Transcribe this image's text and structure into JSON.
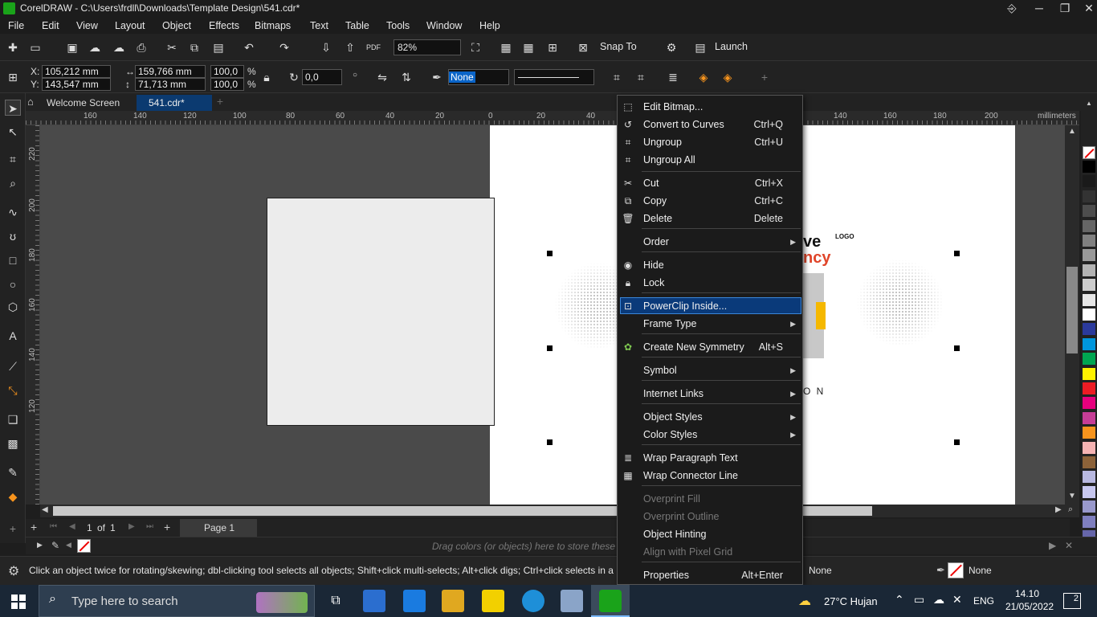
{
  "window": {
    "title": "CorelDRAW - C:\\Users\\frdll\\Downloads\\Template Design\\541.cdr*",
    "controls": [
      "⎆",
      "─",
      "❐",
      "✕"
    ]
  },
  "menu": [
    "File",
    "Edit",
    "View",
    "Layout",
    "Object",
    "Effects",
    "Bitmaps",
    "Text",
    "Table",
    "Tools",
    "Window",
    "Help"
  ],
  "std_toolbar": {
    "zoom": "82%",
    "snap_to": "Snap To",
    "launch": "Launch",
    "pdf_label": "PDF"
  },
  "property_bar": {
    "x_label": "X:",
    "x": "105,212 mm",
    "y_label": "Y:",
    "y": "143,547 mm",
    "width": "159,766 mm",
    "height": "71,713 mm",
    "scale_w": "100,0",
    "scale_h": "100,0",
    "percent": "%",
    "rotation": "0,0",
    "outline": "None"
  },
  "tabs": {
    "welcome": "Welcome Screen",
    "doc": "541.cdr*"
  },
  "rulers": {
    "h_ticks": [
      "160",
      "140",
      "120",
      "100",
      "80",
      "60",
      "40",
      "20",
      "0",
      "20",
      "40",
      "140",
      "160",
      "180",
      "200"
    ],
    "v_ticks": [
      "220",
      "200",
      "180",
      "160",
      "140",
      "120"
    ],
    "unit": "millimeters"
  },
  "design_preview": {
    "logo": "LOGO",
    "frag_ve": "ve",
    "frag_ncy": "ncy",
    "frag_on": "O N"
  },
  "page_nav": {
    "current": "1",
    "of": "of",
    "total": "1",
    "page_tab": "Page 1"
  },
  "color_docker_hint": "Drag colors (or objects) here to store these co",
  "status": {
    "hint": "Click an object twice for rotating/skewing; dbl-clicking tool selects all objects; Shift+click multi-selects; Alt+click digs; Ctrl+click selects in a",
    "fill": "None",
    "outline": "None"
  },
  "context_menu": {
    "items": [
      {
        "label": "Edit Bitmap...",
        "shortcut": "",
        "submenu": false,
        "disabled": false,
        "icon": "edit-bitmap-icon"
      },
      {
        "label": "Convert to Curves",
        "shortcut": "Ctrl+Q",
        "submenu": false,
        "disabled": false,
        "icon": "convert-curves-icon"
      },
      {
        "label": "Ungroup",
        "shortcut": "Ctrl+U",
        "submenu": false,
        "disabled": false,
        "icon": "ungroup-icon"
      },
      {
        "label": "Ungroup All",
        "shortcut": "",
        "submenu": false,
        "disabled": false,
        "icon": "ungroup-all-icon"
      },
      {
        "label": "Cut",
        "shortcut": "Ctrl+X",
        "submenu": false,
        "disabled": false,
        "icon": "cut-icon"
      },
      {
        "label": "Copy",
        "shortcut": "Ctrl+C",
        "submenu": false,
        "disabled": false,
        "icon": "copy-icon"
      },
      {
        "label": "Delete",
        "shortcut": "Delete",
        "submenu": false,
        "disabled": false,
        "icon": "trash-icon"
      },
      {
        "label": "Order",
        "shortcut": "",
        "submenu": true,
        "disabled": false,
        "icon": ""
      },
      {
        "label": "Hide",
        "shortcut": "",
        "submenu": false,
        "disabled": false,
        "icon": "eye-icon"
      },
      {
        "label": "Lock",
        "shortcut": "",
        "submenu": false,
        "disabled": false,
        "icon": "lock-icon"
      },
      {
        "label": "PowerClip Inside...",
        "shortcut": "",
        "submenu": false,
        "disabled": false,
        "icon": "powerclip-icon"
      },
      {
        "label": "Frame Type",
        "shortcut": "",
        "submenu": true,
        "disabled": false,
        "icon": ""
      },
      {
        "label": "Create New Symmetry",
        "shortcut": "Alt+S",
        "submenu": false,
        "disabled": false,
        "icon": "symmetry-icon"
      },
      {
        "label": "Symbol",
        "shortcut": "",
        "submenu": true,
        "disabled": false,
        "icon": ""
      },
      {
        "label": "Internet Links",
        "shortcut": "",
        "submenu": true,
        "disabled": false,
        "icon": ""
      },
      {
        "label": "Object Styles",
        "shortcut": "",
        "submenu": true,
        "disabled": false,
        "icon": ""
      },
      {
        "label": "Color Styles",
        "shortcut": "",
        "submenu": true,
        "disabled": false,
        "icon": ""
      },
      {
        "label": "Wrap Paragraph Text",
        "shortcut": "",
        "submenu": false,
        "disabled": false,
        "icon": "wrap-text-icon"
      },
      {
        "label": "Wrap Connector Line",
        "shortcut": "",
        "submenu": false,
        "disabled": false,
        "icon": "wrap-connector-icon"
      },
      {
        "label": "Overprint Fill",
        "shortcut": "",
        "submenu": false,
        "disabled": true,
        "icon": ""
      },
      {
        "label": "Overprint Outline",
        "shortcut": "",
        "submenu": false,
        "disabled": true,
        "icon": ""
      },
      {
        "label": "Object Hinting",
        "shortcut": "",
        "submenu": false,
        "disabled": false,
        "icon": ""
      },
      {
        "label": "Align with Pixel Grid",
        "shortcut": "",
        "submenu": false,
        "disabled": true,
        "icon": ""
      },
      {
        "label": "Properties",
        "shortcut": "Alt+Enter",
        "submenu": false,
        "disabled": false,
        "icon": ""
      }
    ],
    "highlighted": "PowerClip Inside..."
  },
  "taskbar": {
    "search_placeholder": "Type here to search",
    "weather": "27°C  Hujan",
    "lang": "ENG",
    "time": "14.10",
    "date": "21/05/2022",
    "notifications": "2"
  },
  "colors": {
    "accent": "#1aa31a",
    "menu_highlight": "#0a3a7a",
    "taskbar": "#1a2736"
  },
  "palette": [
    "#000000",
    "#1a1a1a",
    "#333333",
    "#4d4d4d",
    "#666666",
    "#808080",
    "#999999",
    "#b3b3b3",
    "#cccccc",
    "#e6e6e6",
    "#ffffff",
    "#2b3a9c",
    "#0096dc",
    "#00a651",
    "#fff200",
    "#ed1c24",
    "#e6007e",
    "#c63d96",
    "#f7941d",
    "#f5b3b3",
    "#8c6239",
    "#b8b8e0",
    "#c8c8f0",
    "#9999cc",
    "#7f7fbf",
    "#6666aa"
  ]
}
